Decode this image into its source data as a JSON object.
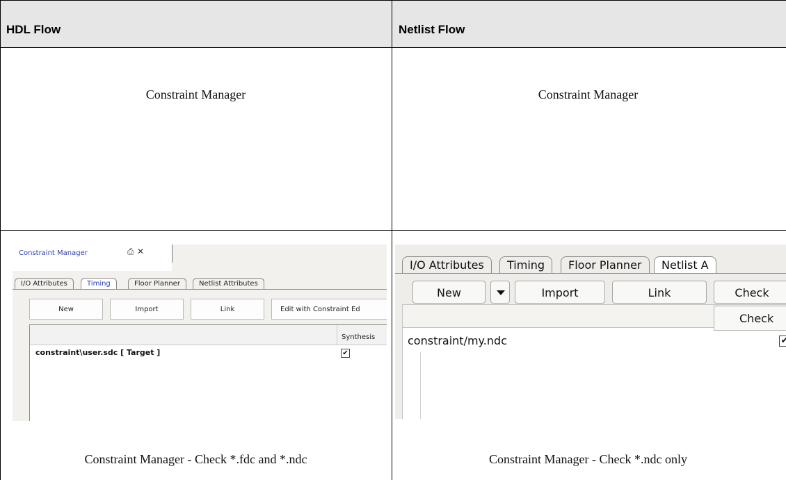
{
  "table": {
    "headers": [
      "HDL Flow",
      "Netlist Flow"
    ],
    "row1": [
      "Constraint Manager",
      "Constraint Manager"
    ],
    "captions": [
      "Constraint Manager - Check *.fdc and *.ndc",
      "Constraint Manager - Check *.ndc only"
    ]
  },
  "left_shot": {
    "panel_title": "Constraint Manager",
    "tabs": [
      "I/O Attributes",
      "Timing",
      "Floor Planner",
      "Netlist Attributes"
    ],
    "active_tab": "Timing",
    "buttons": [
      "New",
      "Import",
      "Link",
      "Edit with Constraint Ed"
    ],
    "column_header": "Synthesis",
    "row_file": "constraint\\user.sdc  [ Target ]",
    "row_checked": true
  },
  "right_shot": {
    "tabs": [
      "I/O Attributes",
      "Timing",
      "Floor Planner",
      "Netlist A"
    ],
    "active_tab": "Netlist A",
    "buttons": [
      "New",
      "Import",
      "Link",
      "Check"
    ],
    "popup_item": "Check",
    "row_file": "constraint/my.ndc",
    "row_checked": true
  },
  "colors": {
    "header_bg": "#e6e6e6",
    "active_tab_text": "#2d3fb5"
  }
}
